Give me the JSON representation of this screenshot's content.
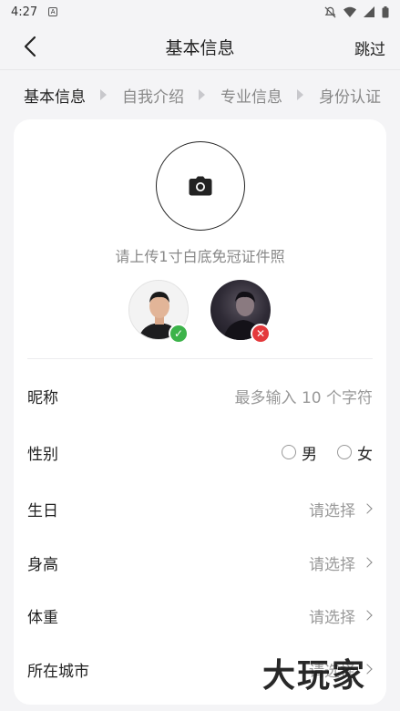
{
  "status": {
    "time": "4:27",
    "app_badge": "A"
  },
  "nav": {
    "title": "基本信息",
    "skip_label": "跳过"
  },
  "steps": [
    "基本信息",
    "自我介绍",
    "专业信息",
    "身份认证"
  ],
  "photo": {
    "hint": "请上传1寸白底免冠证件照"
  },
  "form": {
    "nickname": {
      "label": "昵称",
      "placeholder": "最多输入 10 个字符"
    },
    "gender": {
      "label": "性别",
      "options": [
        "男",
        "女"
      ]
    },
    "birthday": {
      "label": "生日",
      "value": "请选择"
    },
    "height": {
      "label": "身高",
      "value": "请选择"
    },
    "weight": {
      "label": "体重",
      "value": "请选择"
    },
    "city": {
      "label": "所在城市",
      "value": "请选择"
    }
  },
  "watermark": "大玩家"
}
